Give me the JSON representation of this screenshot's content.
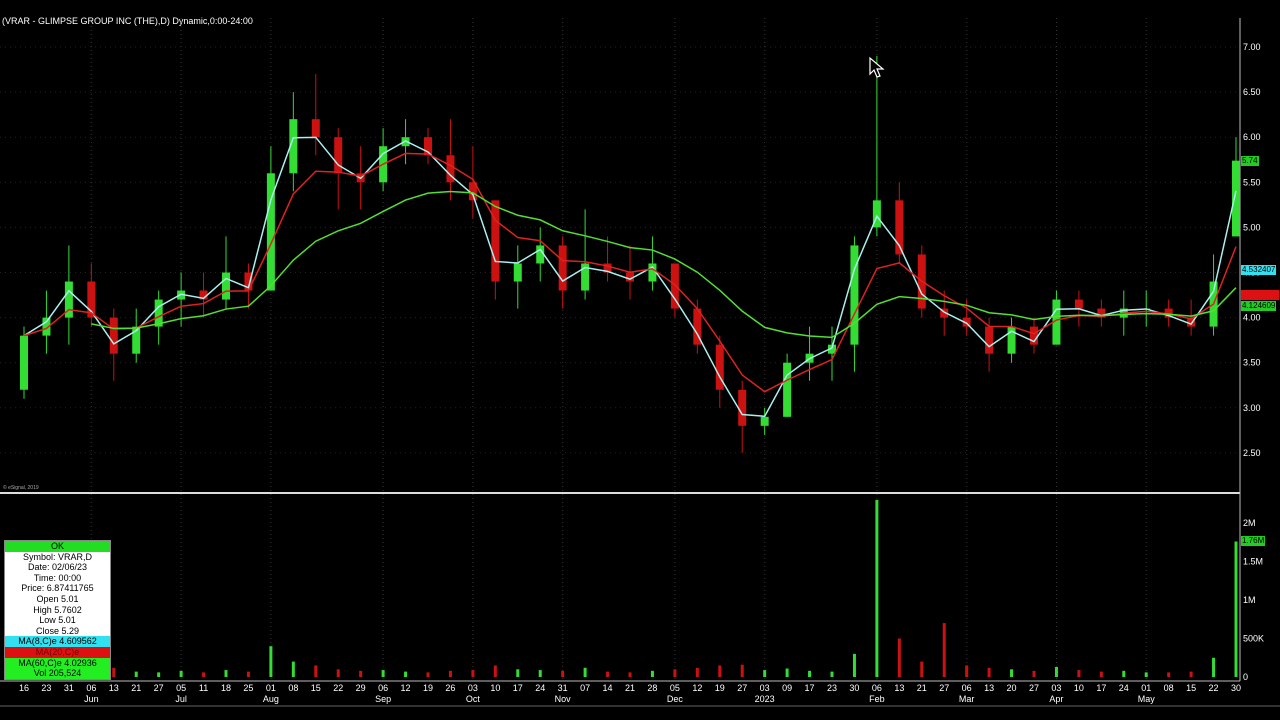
{
  "title": "(VRAR - GLIMPSE GROUP INC (THE),D) Dynamic,0:00-24:00",
  "copyright": "© eSignal, 2019",
  "info": {
    "status": "OK",
    "symbol": "Symbol: VRAR,D",
    "date": "Date: 02/06/23",
    "time": "Time: 00:00",
    "price": "Price: 6.87411765",
    "open": "Open  5.01",
    "high": "High 5.7602",
    "low": "Low  5.01",
    "close": "Close  5.29",
    "ma8": "MA(8,C)e 4.609562",
    "ma20": "MA(20,C)e",
    "ma60": "MA(60,C)e 4.02936",
    "vol": "Vol 205,524"
  },
  "labels": {
    "last": "5.74",
    "ma8": "4.532407",
    "ma20": "",
    "ma60": "4.124609",
    "vol": "1.76M"
  },
  "colors": {
    "up": "#33dd33",
    "down": "#cc1111",
    "ma8": "#aaf0f0",
    "ma20": "#dd2222",
    "ma60": "#55dd33"
  },
  "chart_data": {
    "type": "candlestick",
    "title": "VRAR - GLIMPSE GROUP INC (THE), D",
    "price_ticks": [
      "7.00",
      "6.50",
      "6.00",
      "5.50",
      "5.00",
      "4.50",
      "4.00",
      "3.50",
      "3.00",
      "2.50"
    ],
    "ylim": [
      2.3,
      7.3
    ],
    "volume_ticks": [
      "2M",
      "1.5M",
      "1M",
      "500K",
      "0"
    ],
    "x_ticks": [
      "16",
      "23",
      "31",
      "06",
      "13",
      "21",
      "27",
      "05",
      "11",
      "18",
      "25",
      "01",
      "08",
      "15",
      "22",
      "29",
      "06",
      "12",
      "19",
      "26",
      "03",
      "10",
      "17",
      "24",
      "31",
      "07",
      "14",
      "21",
      "28",
      "05",
      "12",
      "19",
      "27",
      "03",
      "09",
      "17",
      "23",
      "30",
      "06",
      "13",
      "21",
      "27",
      "06",
      "13",
      "20",
      "27",
      "03",
      "10",
      "17",
      "24",
      "01",
      "08",
      "15",
      "22",
      "30"
    ],
    "months": [
      {
        "label": "Jun",
        "at": 3
      },
      {
        "label": "Jul",
        "at": 7
      },
      {
        "label": "Aug",
        "at": 11
      },
      {
        "label": "Sep",
        "at": 16
      },
      {
        "label": "Oct",
        "at": 20
      },
      {
        "label": "Nov",
        "at": 24
      },
      {
        "label": "Dec",
        "at": 29
      },
      {
        "label": "2023",
        "at": 33
      },
      {
        "label": "Feb",
        "at": 38
      },
      {
        "label": "Mar",
        "at": 42
      },
      {
        "label": "Apr",
        "at": 46
      },
      {
        "label": "May",
        "at": 50
      }
    ],
    "ohlc": [
      [
        3.2,
        3.9,
        3.1,
        3.8
      ],
      [
        3.8,
        4.3,
        3.6,
        4.0
      ],
      [
        4.0,
        4.8,
        3.7,
        4.4
      ],
      [
        4.4,
        4.6,
        3.9,
        4.0
      ],
      [
        4.0,
        4.1,
        3.3,
        3.6
      ],
      [
        3.6,
        4.1,
        3.5,
        3.9
      ],
      [
        3.9,
        4.3,
        3.7,
        4.2
      ],
      [
        4.2,
        4.5,
        3.9,
        4.3
      ],
      [
        4.3,
        4.5,
        4.0,
        4.2
      ],
      [
        4.2,
        4.9,
        4.1,
        4.5
      ],
      [
        4.5,
        4.6,
        4.1,
        4.3
      ],
      [
        4.3,
        5.9,
        4.3,
        5.6
      ],
      [
        5.6,
        6.5,
        5.4,
        6.2
      ],
      [
        6.2,
        6.7,
        5.8,
        6.0
      ],
      [
        6.0,
        6.1,
        5.2,
        5.6
      ],
      [
        5.6,
        5.9,
        5.2,
        5.5
      ],
      [
        5.5,
        6.1,
        5.4,
        5.9
      ],
      [
        5.9,
        6.2,
        5.7,
        6.0
      ],
      [
        6.0,
        6.1,
        5.7,
        5.8
      ],
      [
        5.8,
        6.2,
        5.3,
        5.5
      ],
      [
        5.5,
        5.9,
        5.1,
        5.3
      ],
      [
        5.3,
        5.3,
        4.2,
        4.4
      ],
      [
        4.4,
        4.8,
        4.1,
        4.6
      ],
      [
        4.6,
        5.0,
        4.4,
        4.8
      ],
      [
        4.8,
        4.9,
        4.1,
        4.3
      ],
      [
        4.3,
        5.2,
        4.2,
        4.6
      ],
      [
        4.6,
        4.9,
        4.4,
        4.5
      ],
      [
        4.5,
        4.8,
        4.2,
        4.4
      ],
      [
        4.4,
        4.9,
        4.3,
        4.6
      ],
      [
        4.6,
        4.6,
        4.0,
        4.1
      ],
      [
        4.1,
        4.2,
        3.6,
        3.7
      ],
      [
        3.7,
        3.8,
        3.0,
        3.2
      ],
      [
        3.2,
        3.3,
        2.5,
        2.8
      ],
      [
        2.8,
        3.0,
        2.7,
        2.9
      ],
      [
        2.9,
        3.6,
        2.9,
        3.5
      ],
      [
        3.5,
        3.9,
        3.3,
        3.6
      ],
      [
        3.6,
        3.9,
        3.3,
        3.7
      ],
      [
        3.7,
        4.9,
        3.4,
        4.8
      ],
      [
        5.0,
        6.9,
        4.9,
        5.3
      ],
      [
        5.3,
        5.5,
        4.6,
        4.7
      ],
      [
        4.7,
        4.8,
        4.0,
        4.1
      ],
      [
        4.1,
        4.3,
        3.8,
        4.0
      ],
      [
        4.0,
        4.2,
        3.8,
        3.9
      ],
      [
        3.9,
        4.0,
        3.4,
        3.6
      ],
      [
        3.6,
        4.0,
        3.5,
        3.9
      ],
      [
        3.9,
        4.0,
        3.6,
        3.7
      ],
      [
        3.7,
        4.3,
        3.7,
        4.2
      ],
      [
        4.2,
        4.3,
        3.9,
        4.1
      ],
      [
        4.1,
        4.2,
        3.9,
        4.0
      ],
      [
        4.0,
        4.3,
        3.8,
        4.1
      ],
      [
        4.1,
        4.3,
        3.9,
        4.1
      ],
      [
        4.1,
        4.2,
        3.9,
        4.0
      ],
      [
        4.0,
        4.2,
        3.8,
        3.9
      ],
      [
        3.9,
        4.7,
        3.8,
        4.4
      ],
      [
        4.9,
        6.0,
        4.9,
        5.74
      ]
    ],
    "volume_k": [
      90,
      110,
      150,
      80,
      120,
      70,
      60,
      80,
      60,
      90,
      70,
      400,
      200,
      150,
      100,
      80,
      90,
      70,
      60,
      80,
      90,
      150,
      100,
      90,
      80,
      120,
      70,
      60,
      80,
      100,
      120,
      150,
      160,
      90,
      110,
      80,
      70,
      300,
      2300,
      500,
      200,
      700,
      150,
      120,
      100,
      80,
      130,
      90,
      70,
      80,
      60,
      60,
      70,
      250,
      1760
    ],
    "ma_periods": [
      8,
      20,
      60
    ]
  }
}
